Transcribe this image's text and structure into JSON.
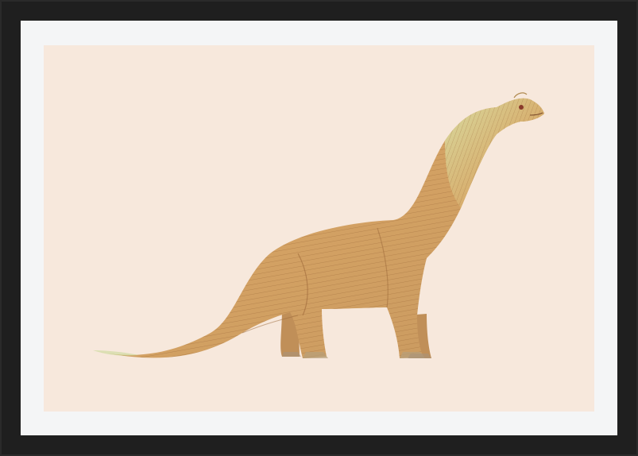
{
  "artwork": {
    "subject_icon": "brachiosaurus-illustration",
    "colors": {
      "frame": "#1f1f1f",
      "mat": "#f4f5f6",
      "paper": "#f7e8dc",
      "body": "#d6a86a",
      "body_light": "#e8c98f",
      "stripe": "#a6703f",
      "green_tint": "#c9d99a"
    }
  }
}
